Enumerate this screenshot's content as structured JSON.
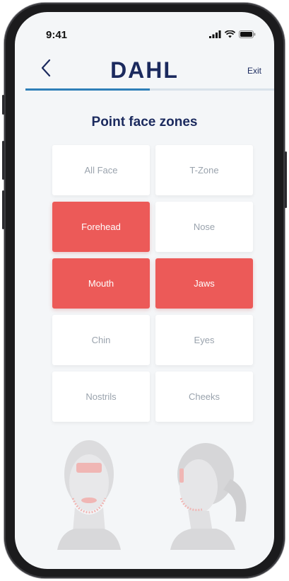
{
  "status_bar": {
    "time": "9:41",
    "signal_icon": "signal-icon",
    "wifi_icon": "wifi-icon",
    "battery_icon": "battery-icon"
  },
  "header": {
    "back_icon": "chevron-left-icon",
    "logo": "DAHL",
    "exit_label": "Exit"
  },
  "progress": {
    "fraction": 0.5
  },
  "page": {
    "title": "Point face zones"
  },
  "zones": [
    {
      "label": "All Face",
      "selected": false
    },
    {
      "label": "T-Zone",
      "selected": false
    },
    {
      "label": "Forehead",
      "selected": true
    },
    {
      "label": "Nose",
      "selected": false
    },
    {
      "label": "Mouth",
      "selected": true
    },
    {
      "label": "Jaws",
      "selected": true
    },
    {
      "label": "Chin",
      "selected": false
    },
    {
      "label": "Eyes",
      "selected": false
    },
    {
      "label": "Nostrils",
      "selected": false
    },
    {
      "label": "Cheeks",
      "selected": false
    }
  ],
  "colors": {
    "accent": "#ec5a58",
    "brand": "#1b2a5e",
    "progress": "#2f7fb8"
  }
}
